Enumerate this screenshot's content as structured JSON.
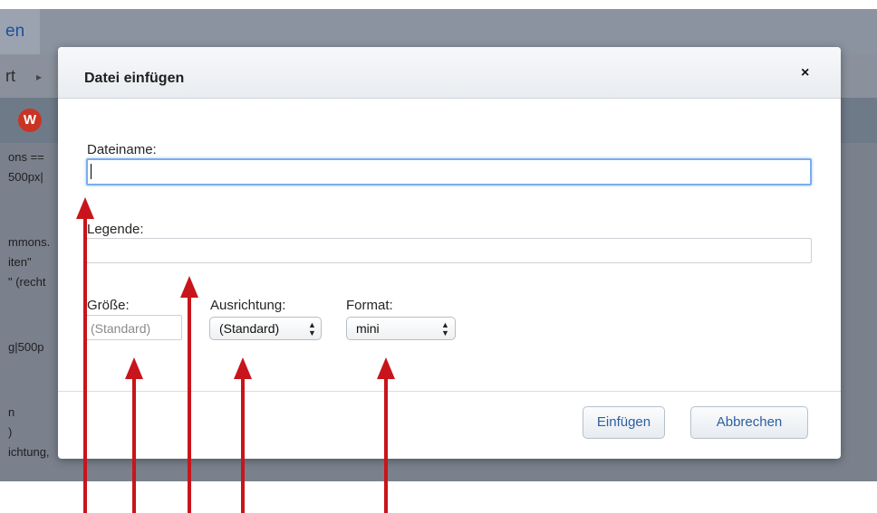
{
  "background": {
    "tab_label": "en",
    "toolbar_label": "rt",
    "toolbar_arrow": "▸",
    "editor_lines": [
      "ons ==",
      "500px|",
      "mmons.",
      "iten\"",
      "\" (recht",
      "g|500p",
      "n",
      ")",
      "ichtung,"
    ]
  },
  "dialog": {
    "title": "Datei einfügen",
    "close_label": "×",
    "filename": {
      "label": "Dateiname:",
      "value": ""
    },
    "caption": {
      "label": "Legende:",
      "value": ""
    },
    "size": {
      "label": "Größe:",
      "placeholder": "(Standard)"
    },
    "alignment": {
      "label": "Ausrichtung:",
      "value": "(Standard)"
    },
    "format": {
      "label": "Format:",
      "value": "mini"
    },
    "buttons": {
      "insert": "Einfügen",
      "cancel": "Abbrechen"
    }
  },
  "annotations": {
    "color": "#c8151b",
    "count": 5
  }
}
